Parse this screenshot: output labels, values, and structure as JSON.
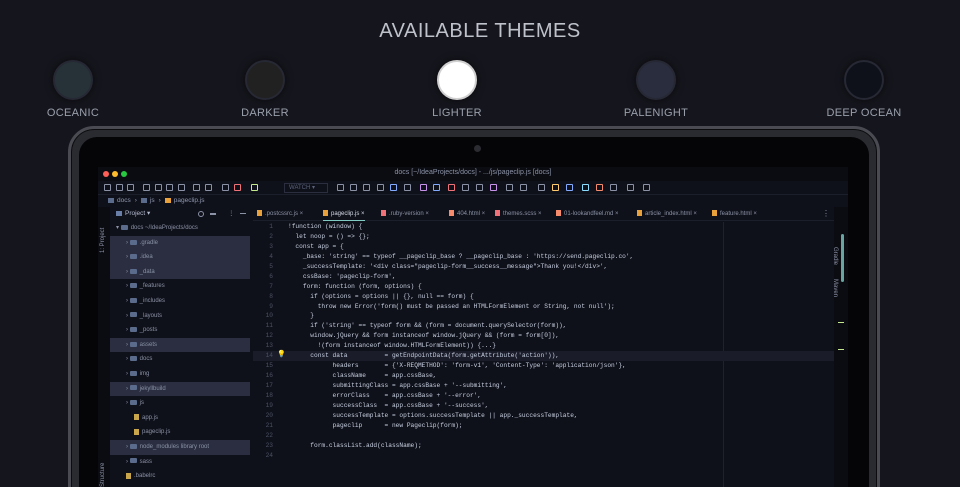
{
  "heading": "AVAILABLE THEMES",
  "themes": [
    {
      "label": "OCEANIC",
      "color": "#263238"
    },
    {
      "label": "DARKER",
      "color": "#212121"
    },
    {
      "label": "LIGHTER",
      "color": "#ffffff"
    },
    {
      "label": "PALENIGHT",
      "color": "#292d3e"
    },
    {
      "label": "DEEP OCEAN",
      "color": "#0f111a"
    }
  ],
  "window": {
    "title": "docs [~/IdeaProjects/docs] - .../js/pageclip.js [docs]"
  },
  "toolbar": {
    "watch_label": "WATCH"
  },
  "breadcrumb": [
    "docs",
    "js",
    "pageclip.js"
  ],
  "sidebar": {
    "panel_label": "Project",
    "left_strip_top": "1: Project",
    "left_strip_bottom": "Structure",
    "root": "docs ~/IdeaProjects/docs",
    "items": [
      {
        "label": ".gradle",
        "indent": 2,
        "type": "folder",
        "hl": true
      },
      {
        "label": ".idea",
        "indent": 2,
        "type": "folder",
        "hl": true
      },
      {
        "label": "_data",
        "indent": 2,
        "type": "folder",
        "hl": true
      },
      {
        "label": "_features",
        "indent": 2,
        "type": "folder"
      },
      {
        "label": "_includes",
        "indent": 2,
        "type": "folder"
      },
      {
        "label": "_layouts",
        "indent": 2,
        "type": "folder"
      },
      {
        "label": "_posts",
        "indent": 2,
        "type": "folder"
      },
      {
        "label": "assets",
        "indent": 2,
        "type": "folder",
        "hl": true
      },
      {
        "label": "docs",
        "indent": 2,
        "type": "folder"
      },
      {
        "label": "img",
        "indent": 2,
        "type": "folder"
      },
      {
        "label": "jekyllbuild",
        "indent": 2,
        "type": "folder",
        "hl": true
      },
      {
        "label": "js",
        "indent": 2,
        "type": "folder"
      },
      {
        "label": "app.js",
        "indent": 3,
        "type": "file"
      },
      {
        "label": "pageclip.js",
        "indent": 3,
        "type": "file"
      },
      {
        "label": "node_modules  library root",
        "indent": 2,
        "type": "folder",
        "hl": true
      },
      {
        "label": "sass",
        "indent": 2,
        "type": "folder"
      },
      {
        "label": ".babelrc",
        "indent": 2,
        "type": "file"
      }
    ]
  },
  "tabs": [
    {
      "label": ".postcssrc.js",
      "active": false
    },
    {
      "label": "pageclip.js",
      "active": true
    },
    {
      "label": ".ruby-version",
      "active": false
    },
    {
      "label": "404.html",
      "active": false
    },
    {
      "label": "themes.scss",
      "active": false
    },
    {
      "label": "01-lookandfeel.md",
      "active": false
    },
    {
      "label": "article_index.html",
      "active": false
    },
    {
      "label": "feature.html",
      "active": false
    }
  ],
  "right_strip": [
    "Gradle",
    "Maven"
  ],
  "code": [
    {
      "n": "1",
      "t": "!function (window) {"
    },
    {
      "n": "2",
      "t": "  let noop = () => {};"
    },
    {
      "n": "3",
      "t": "  const app = {"
    },
    {
      "n": "4",
      "t": "    _base: 'string' == typeof __pageclip_base ? __pageclip_base : 'https://send.pageclip.co',"
    },
    {
      "n": "5",
      "t": "    _successTemplate: '<div class=\"pageclip-form__success__message\">Thank you!</div>',"
    },
    {
      "n": "6",
      "t": "    cssBase: 'pageclip-form',"
    },
    {
      "n": "7",
      "t": "    form: function (form, options) {"
    },
    {
      "n": "8",
      "t": "      if (options = options || {}, null == form) {"
    },
    {
      "n": "9",
      "t": "        throw new Error('form() must be passed an HTMLFormElement or String, not null');"
    },
    {
      "n": "10",
      "t": "      }"
    },
    {
      "n": "11",
      "t": "      if ('string' == typeof form && (form = document.querySelector(form)),"
    },
    {
      "n": "12",
      "t": "      window.jQuery && form instanceof window.jQuery && (form = form[0]),"
    },
    {
      "n": "13",
      "t": "        !(form instanceof window.HTMLFormElement)) {...}"
    },
    {
      "n": "14",
      "t": "      const data          = getEndpointData(form.getAttribute('action')),"
    },
    {
      "n": "15",
      "t": "            headers       = {'X-REQMETHOD': 'form-v1', 'Content-Type': 'application/json'},"
    },
    {
      "n": "16",
      "t": "            className     = app.cssBase,"
    },
    {
      "n": "17",
      "t": "            submittingClass = app.cssBase + '--submitting',"
    },
    {
      "n": "18",
      "t": "            errorClass    = app.cssBase + '--error',"
    },
    {
      "n": "19",
      "t": "            successClass  = app.cssBase + '--success',"
    },
    {
      "n": "20",
      "t": "            successTemplate = options.successTemplate || app._successTemplate,"
    },
    {
      "n": "21",
      "t": "            pageclip      = new Pageclip(form);"
    },
    {
      "n": "22",
      "t": ""
    },
    {
      "n": "23",
      "t": "      form.classList.add(className);"
    },
    {
      "n": "24",
      "t": ""
    }
  ]
}
